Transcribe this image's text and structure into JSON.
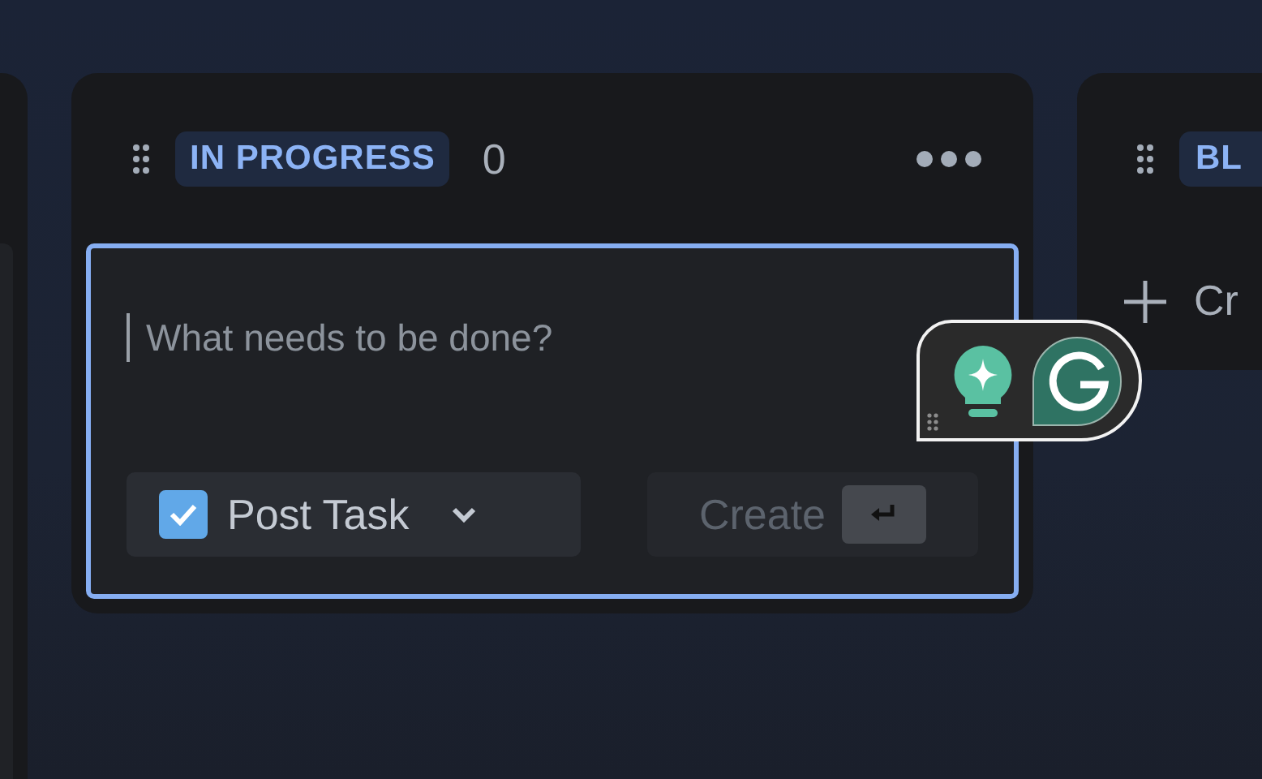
{
  "board": {
    "columns": [
      {
        "kind": "partial"
      },
      {
        "kind": "full",
        "status": "IN PROGRESS",
        "count": "0",
        "composer": {
          "placeholder": "What needs to be done?",
          "post_task": {
            "label": "Post Task",
            "checked": true
          },
          "create_button": {
            "label": "Create",
            "disabled": true
          }
        }
      },
      {
        "kind": "collapsed",
        "status": "BL",
        "create_label": "Cr"
      }
    ]
  }
}
